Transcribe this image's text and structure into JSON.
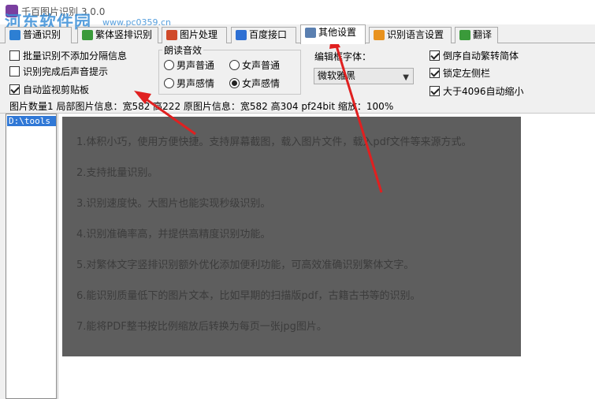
{
  "window": {
    "title": "千百图片识别 3.0.0",
    "watermark": "河东软件园",
    "watermark_url": "www.pc0359.cn"
  },
  "tabs": [
    {
      "label": "普通识别",
      "icon": "image-icon",
      "color": "#2d7fd3"
    },
    {
      "label": "繁体竖排识别",
      "icon": "document-icon",
      "color": "#3a9a3a"
    },
    {
      "label": "图片处理",
      "icon": "palette-icon",
      "color": "#d04a2a"
    },
    {
      "label": "百度接口",
      "icon": "network-icon",
      "color": "#2d6fd3"
    },
    {
      "label": "其他设置",
      "icon": "settings-icon",
      "color": "#5a7fb0",
      "active": true
    },
    {
      "label": "识别语言设置",
      "icon": "rss-icon",
      "color": "#e8921e"
    },
    {
      "label": "翻译",
      "icon": "translate-icon",
      "color": "#3a9a3a"
    }
  ],
  "settings": {
    "options_left": [
      {
        "label": "批量识别不添加分隔信息",
        "checked": false
      },
      {
        "label": "识别完成后声音提示",
        "checked": false
      },
      {
        "label": "自动监视剪贴板",
        "checked": true
      }
    ],
    "voice_group": {
      "title": "朗读音效",
      "options": [
        {
          "label": "男声普通",
          "selected": false
        },
        {
          "label": "女声普通",
          "selected": false
        },
        {
          "label": "男声感情",
          "selected": false
        },
        {
          "label": "女声感情",
          "selected": true
        }
      ]
    },
    "editor_font_label": "编辑框字体：",
    "editor_font_value": "微软雅黑",
    "options_right": [
      {
        "label": "倒序自动繁转简体",
        "checked": true
      },
      {
        "label": "锁定左侧栏",
        "checked": true
      },
      {
        "label": "大于4096自动缩小",
        "checked": true
      }
    ]
  },
  "status_line": "图片数量1 局部图片信息：宽582 高222 原图片信息：宽582 高304 pf24bit 缩放：100%",
  "tree": {
    "items": [
      "D:\\tools"
    ]
  },
  "preview": {
    "lines": [
      "1.体积小巧，使用方便快捷。支持屏幕截图，载入图片文件，载入pdf文件等来源方式。",
      "2.支持批量识别。",
      "3.识别速度快。大图片也能实现秒级识别。",
      "4.识别准确率高，并提供高精度识别功能。",
      "5.对繁体文字竖排识别额外优化添加便利功能，可高效准确识别繁体文字。",
      "6.能识别质量低下的图片文本，比如早期的扫描版pdf，古籍古书等的识别。",
      "7.能将PDF整书按比例缩放后转换为每页一张jpg图片。"
    ]
  },
  "annotation_color": "#e02020"
}
